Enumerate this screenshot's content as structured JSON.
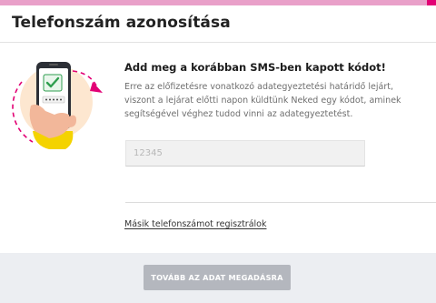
{
  "header": {
    "title": "Telefonszám azonosítása"
  },
  "main": {
    "heading": "Add meg a korábban SMS-ben kapott kódot!",
    "description": "Erre az előfizetésre vonatkozó adategyeztetési határidő lejárt, viszont a lejárat előtti napon küldtünk Neked egy kódot, aminek segítségével véghez tudod vinni az adategyeztetést.",
    "code_input": {
      "placeholder": "12345",
      "value": ""
    },
    "alt_link": "Másik telefonszámot regisztrálok"
  },
  "footer": {
    "submit_label": "TOVÁBB AZ ADAT MEGADÁSRA",
    "submit_enabled": false
  },
  "colors": {
    "brand_magenta": "#e20074",
    "top_bar": "#e9a0c9",
    "disabled_button": "#b4b7be",
    "footer_bg": "#eceef2",
    "illustration_circle": "#fde7d0",
    "check_green": "#2f9e4f"
  },
  "icons": {
    "illustration": "phone-verification-illustration",
    "check": "check-icon",
    "arrow": "curved-arrow-icon"
  }
}
